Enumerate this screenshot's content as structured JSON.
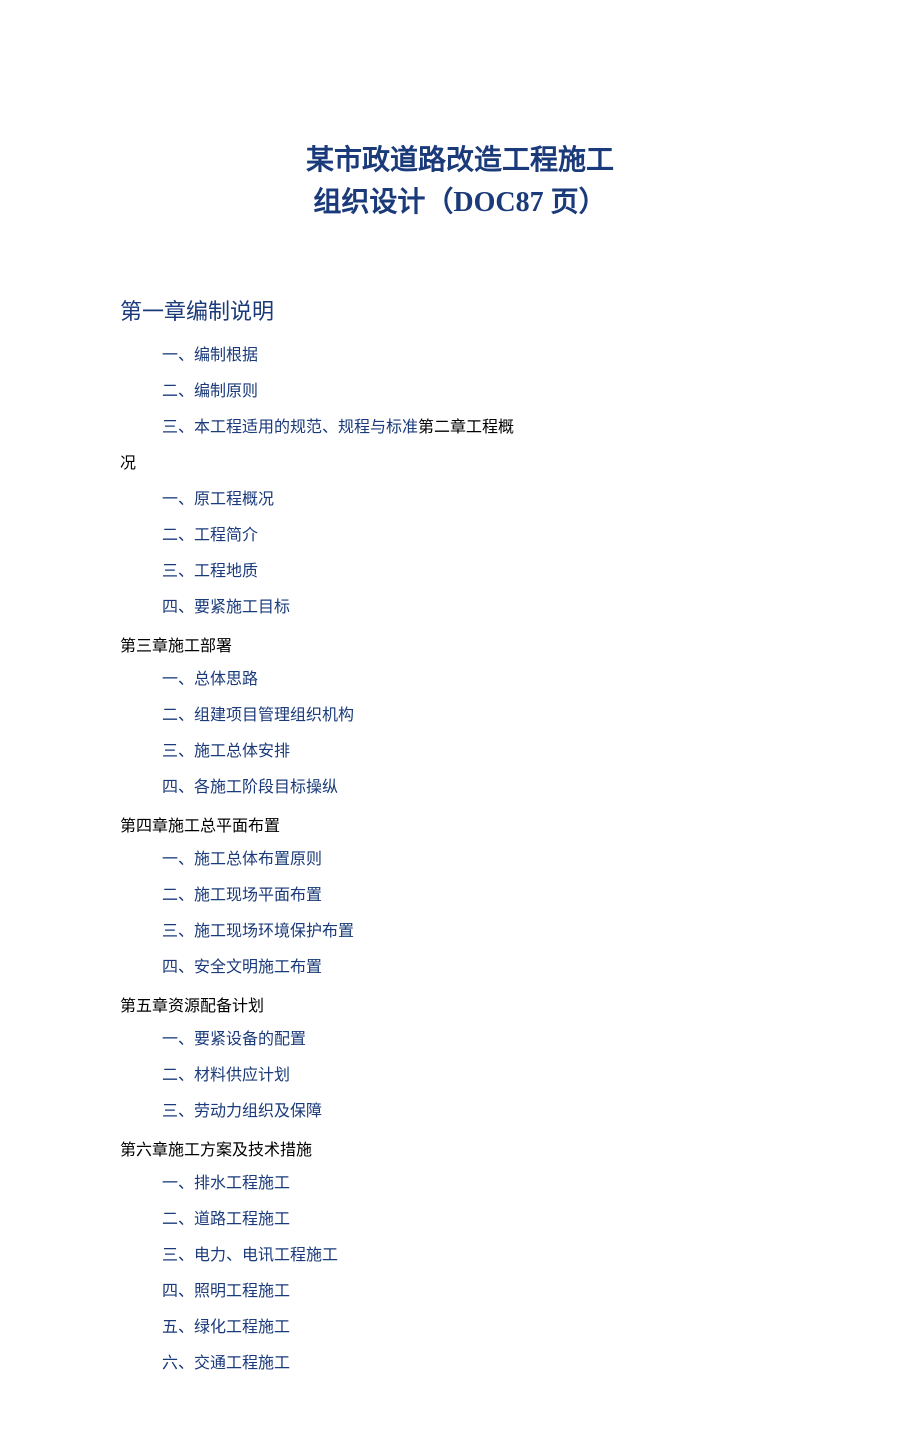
{
  "title_line1": "某市政道路改造工程施工",
  "title_line2_pre": "组织设计（",
  "title_line2_doc": "DOC87",
  "title_line2_post": " 页）",
  "ch1": {
    "heading": "第一章编制说明",
    "i1": "一、编制根据",
    "i2": "二、编制原则",
    "i3": "三、本工程适用的规范、规程与标准",
    "tail": "第二章工程概",
    "wrap": "况"
  },
  "ch2": {
    "i1": "一、原工程概况",
    "i2": "二、工程简介",
    "i3": "三、工程地质",
    "i4": "四、要紧施工目标"
  },
  "ch3": {
    "heading": "第三章施工部署",
    "i1": "一、总体思路",
    "i2": "二、组建项目管理组织机构",
    "i3": "三、施工总体安排",
    "i4": "四、各施工阶段目标操纵"
  },
  "ch4": {
    "heading": "第四章施工总平面布置",
    "i1": "一、施工总体布置原则",
    "i2": "二、施工现场平面布置",
    "i3": "三、施工现场环境保护布置",
    "i4": "四、安全文明施工布置"
  },
  "ch5": {
    "heading": "第五章资源配备计划",
    "i1": "一、要紧设备的配置",
    "i2": "二、材料供应计划",
    "i3": "三、劳动力组织及保障"
  },
  "ch6": {
    "heading": "第六章施工方案及技术措施",
    "i1": "一、排水工程施工",
    "i2": "二、道路工程施工",
    "i3": "三、电力、电讯工程施工",
    "i4": "四、照明工程施工",
    "i5": "五、绿化工程施工",
    "i6": "六、交通工程施工"
  }
}
